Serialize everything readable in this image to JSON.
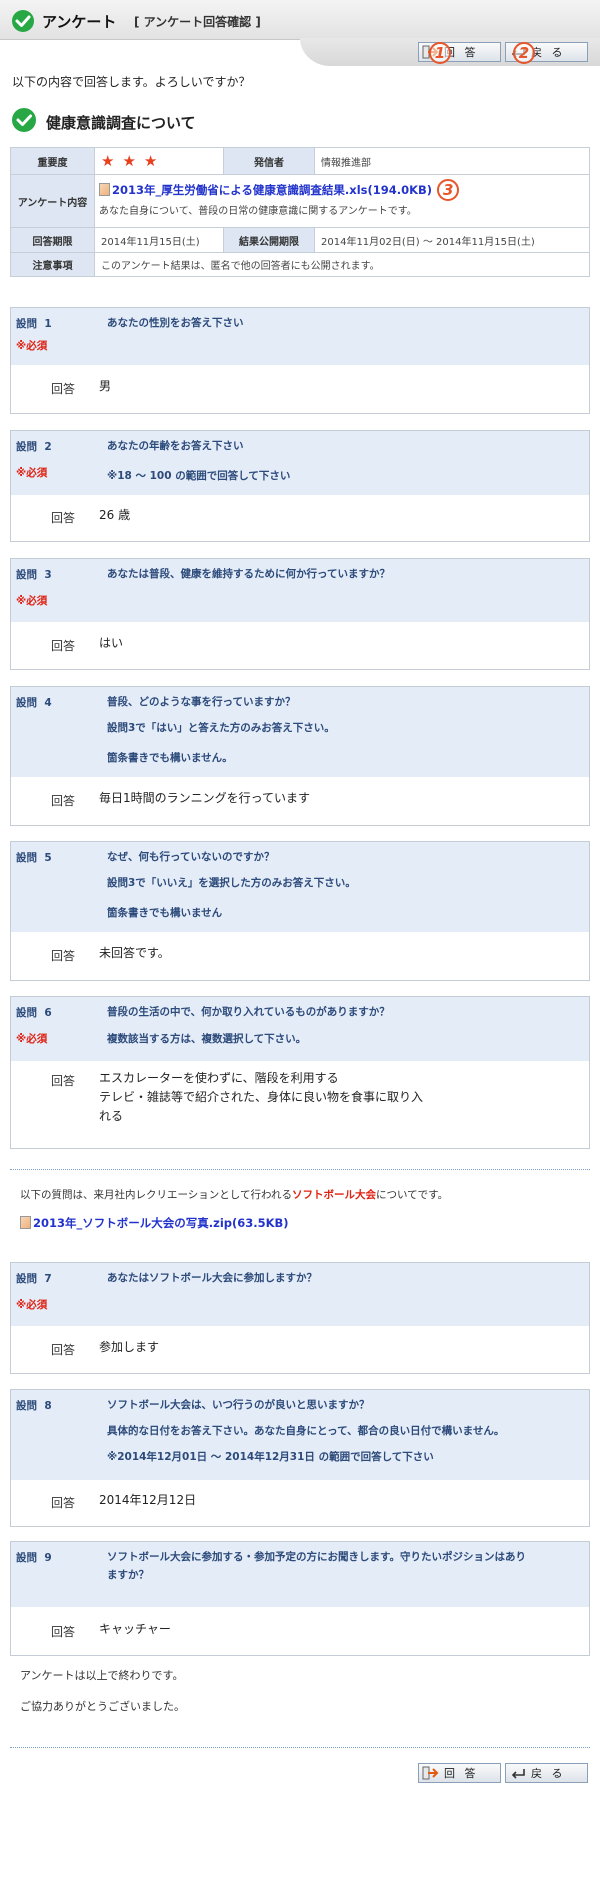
{
  "header": {
    "title": "アンケート",
    "subtitle": "[ アンケート回答確認 ]"
  },
  "buttons": {
    "answer": "回 答",
    "back": "戻 る"
  },
  "badges": [
    "1",
    "2",
    "3"
  ],
  "confirm_text": "以下の内容で回答します。よろしいですか？",
  "section_title": "健康意識調査について",
  "info": {
    "labels": {
      "importance": "重要度",
      "sender": "発信者",
      "content": "アンケート内容",
      "deadline": "回答期限",
      "publish": "結果公開期限",
      "notes": "注意事項"
    },
    "importance_stars": 3,
    "sender": "情報推進部",
    "file_link": "2013年_厚生労働省による健康意識調査結果.xls(194.0KB)",
    "description": "あなた自身について、普段の日常の健康意識に関するアンケートです。",
    "deadline": "2014年11月15日(土)",
    "publish": "2014年11月02日(日) ～ 2014年11月15日(土)",
    "notes": "このアンケート結果は、匿名で他の回答者にも公開されます。"
  },
  "labels": {
    "question": "設問",
    "required": "※必須",
    "answer": "回答"
  },
  "questions": [
    {
      "num": "1",
      "text": "あなたの性別をお答え下さい",
      "answer": "男"
    },
    {
      "num": "2",
      "text": "あなたの年齢をお答え下さい",
      "note": "※18 ～ 100 の範囲で回答して下さい",
      "answer": "26 歳"
    },
    {
      "num": "3",
      "text": "あなたは普段、健康を維持するために何か行っていますか？",
      "answer": "はい"
    },
    {
      "num": "4",
      "text": "普段、どのような事を行っていますか？",
      "note1": "設問3で「はい」と答えた方のみお答え下さい。",
      "note2": "箇条書きでも構いません。",
      "answer": "毎日1時間のランニングを行っています"
    },
    {
      "num": "5",
      "text": "なぜ、何も行っていないのですか？",
      "note1": "設問3で「いいえ」を選択した方のみお答え下さい。",
      "note2": "箇条書きでも構いません",
      "answer": "未回答です。"
    },
    {
      "num": "6",
      "text": "普段の生活の中で、何か取り入れているものがありますか？",
      "note": "複数該当する方は、複数選択して下さい。",
      "answer1": "エスカレーターを使わずに、階段を利用する",
      "answer2": "テレビ・雑誌等で紹介された、身体に良い物を食事に取り入",
      "answer3": "れる"
    },
    {
      "num": "7",
      "text": "あなたはソフトボール大会に参加しますか？",
      "answer": "参加します"
    },
    {
      "num": "8",
      "text": "ソフトボール大会は、いつ行うのが良いと思いますか？",
      "note1": "具体的な日付をお答え下さい。あなた自身にとって、都合の良い日付で構いません。",
      "note2": "※2014年12月01日 ～ 2014年12月31日 の範囲で回答して下さい",
      "answer": "2014年12月12日"
    },
    {
      "num": "9",
      "text": "ソフトボール大会に参加する・参加予定の方にお聞きします。守りたいポジションはあり",
      "text2": "ますか？",
      "answer": "キャッチャー"
    }
  ],
  "softball_note": {
    "before": "以下の質問は、来月社内レクリエーションとして行われる",
    "highlight": "ソフトボール大会",
    "after": "についてです。"
  },
  "softball_file": "2013年_ソフトボール大会の写真.zip(63.5KB)",
  "closing1": "アンケートは以上で終わりです。",
  "closing2": "ご協力ありがとうございました。"
}
